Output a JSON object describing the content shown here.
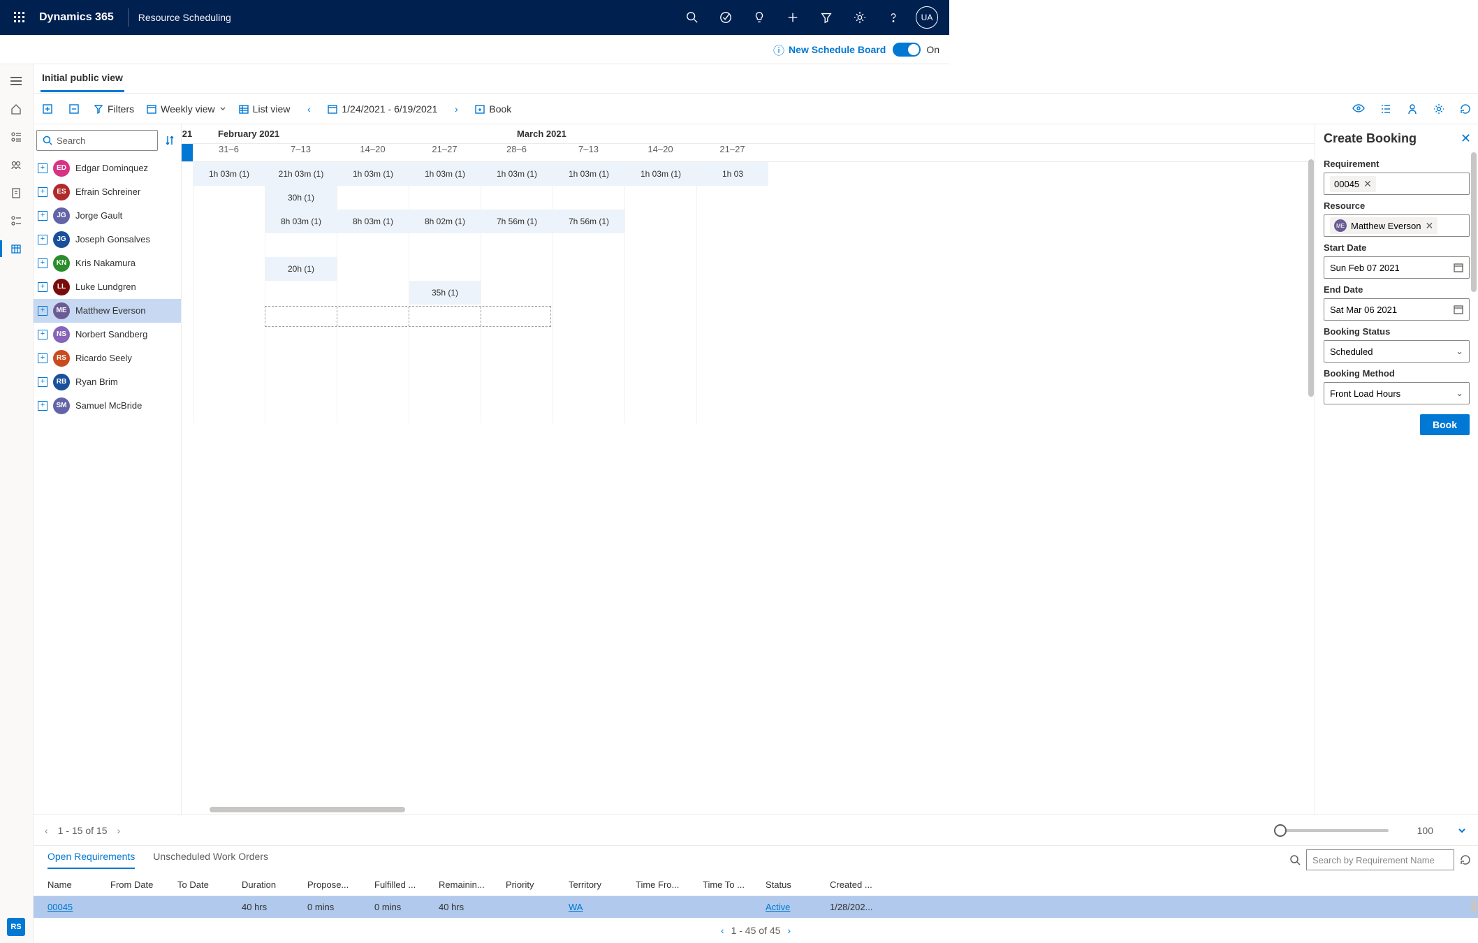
{
  "topbar": {
    "brand": "Dynamics 365",
    "area": "Resource Scheduling",
    "avatar_initials": "UA"
  },
  "second_bar": {
    "label": "New Schedule Board",
    "toggle_state": "On"
  },
  "tabs": {
    "view_tab": "Initial public view"
  },
  "toolbar": {
    "filters": "Filters",
    "weekly_view": "Weekly view",
    "list_view": "List view",
    "date_range": "1/24/2021 - 6/19/2021",
    "book": "Book"
  },
  "search": {
    "placeholder": "Search"
  },
  "months": {
    "feb": "February 2021",
    "mar": "March 2021",
    "yr_partial": "21"
  },
  "week_labels": [
    "31–6",
    "7–13",
    "14–20",
    "21–27",
    "28–6",
    "7–13",
    "14–20",
    "21–27"
  ],
  "resources": [
    {
      "initials": "ED",
      "name": "Edgar Dominquez",
      "color": "#d63384"
    },
    {
      "initials": "ES",
      "name": "Efrain Schreiner",
      "color": "#b02a2a"
    },
    {
      "initials": "JG",
      "name": "Jorge Gault",
      "color": "#6264a7"
    },
    {
      "initials": "JG",
      "name": "Joseph Gonsalves",
      "color": "#1a4f9c"
    },
    {
      "initials": "KN",
      "name": "Kris Nakamura",
      "color": "#2a8c2a"
    },
    {
      "initials": "LL",
      "name": "Luke Lundgren",
      "color": "#7a0b0b"
    },
    {
      "initials": "ME",
      "name": "Matthew Everson",
      "color": "#6b5b95"
    },
    {
      "initials": "NS",
      "name": "Norbert Sandberg",
      "color": "#8764b8"
    },
    {
      "initials": "RS",
      "name": "Ricardo Seely",
      "color": "#c94b1f"
    },
    {
      "initials": "RB",
      "name": "Ryan Brim",
      "color": "#1a4f9c"
    },
    {
      "initials": "SM",
      "name": "Samuel McBride",
      "color": "#6264a7"
    }
  ],
  "grid": {
    "rows": [
      {
        "cells": [
          {
            "t": "1h 03m (1)",
            "f": true
          },
          {
            "t": "21h 03m (1)",
            "f": true
          },
          {
            "t": "1h 03m (1)",
            "f": true
          },
          {
            "t": "1h 03m (1)",
            "f": true
          },
          {
            "t": "1h 03m (1)",
            "f": true
          },
          {
            "t": "1h 03m (1)",
            "f": true
          },
          {
            "t": "1h 03m (1)",
            "f": true
          },
          {
            "t": "1h 03",
            "f": true
          }
        ]
      },
      {
        "cells": [
          {},
          {
            "t": "30h (1)",
            "f": true
          },
          {},
          {},
          {},
          {},
          {},
          {}
        ]
      },
      {
        "cells": [
          {},
          {
            "t": "8h 03m (1)",
            "f": true
          },
          {
            "t": "8h 03m (1)",
            "f": true
          },
          {
            "t": "8h 02m (1)",
            "f": true
          },
          {
            "t": "7h 56m (1)",
            "f": true
          },
          {
            "t": "7h 56m (1)",
            "f": true
          },
          {},
          {}
        ]
      },
      {
        "cells": [
          {},
          {},
          {},
          {},
          {},
          {},
          {},
          {}
        ]
      },
      {
        "cells": [
          {},
          {
            "t": "20h (1)",
            "f": true
          },
          {},
          {},
          {},
          {},
          {},
          {}
        ]
      },
      {
        "cells": [
          {},
          {},
          {},
          {
            "t": "35h (1)",
            "f": true
          },
          {},
          {},
          {},
          {}
        ]
      },
      {
        "cells": [
          {},
          {},
          {},
          {},
          {},
          {},
          {},
          {}
        ],
        "selected": true,
        "sel_start": 1,
        "sel_end": 4
      },
      {
        "cells": [
          {},
          {},
          {},
          {},
          {},
          {},
          {},
          {}
        ]
      },
      {
        "cells": [
          {},
          {},
          {},
          {},
          {},
          {},
          {},
          {}
        ]
      },
      {
        "cells": [
          {},
          {},
          {},
          {},
          {},
          {},
          {},
          {}
        ]
      },
      {
        "cells": [
          {},
          {},
          {},
          {},
          {},
          {},
          {},
          {}
        ]
      }
    ]
  },
  "pager": {
    "text": "1 - 15 of 15",
    "slider_val": "100"
  },
  "booking": {
    "title": "Create Booking",
    "req_label": "Requirement",
    "req_value": "00045",
    "res_label": "Resource",
    "res_value": "Matthew Everson",
    "res_initials": "ME",
    "start_label": "Start Date",
    "start_value": "Sun Feb 07 2021",
    "end_label": "End Date",
    "end_value": "Sat Mar 06 2021",
    "status_label": "Booking Status",
    "status_value": "Scheduled",
    "method_label": "Booking Method",
    "method_value": "Front Load Hours",
    "book_btn": "Book"
  },
  "req_tabs": {
    "open": "Open Requirements",
    "unscheduled": "Unscheduled Work Orders",
    "search_placeholder": "Search by Requirement Name"
  },
  "req_cols": {
    "name": "Name",
    "from": "From Date",
    "to": "To Date",
    "dur": "Duration",
    "prop": "Propose...",
    "fulf": "Fulfilled ...",
    "rem": "Remainin...",
    "pri": "Priority",
    "terr": "Territory",
    "tf": "Time Fro...",
    "tt": "Time To ...",
    "stat": "Status",
    "cre": "Created ..."
  },
  "req_row": {
    "name": "00045",
    "dur": "40 hrs",
    "prop": "0 mins",
    "fulf": "0 mins",
    "rem": "40 hrs",
    "terr": "WA",
    "stat": "Active",
    "cre": "1/28/202..."
  },
  "bottom_pager": "1 - 45 of 45",
  "left_badge": "RS"
}
